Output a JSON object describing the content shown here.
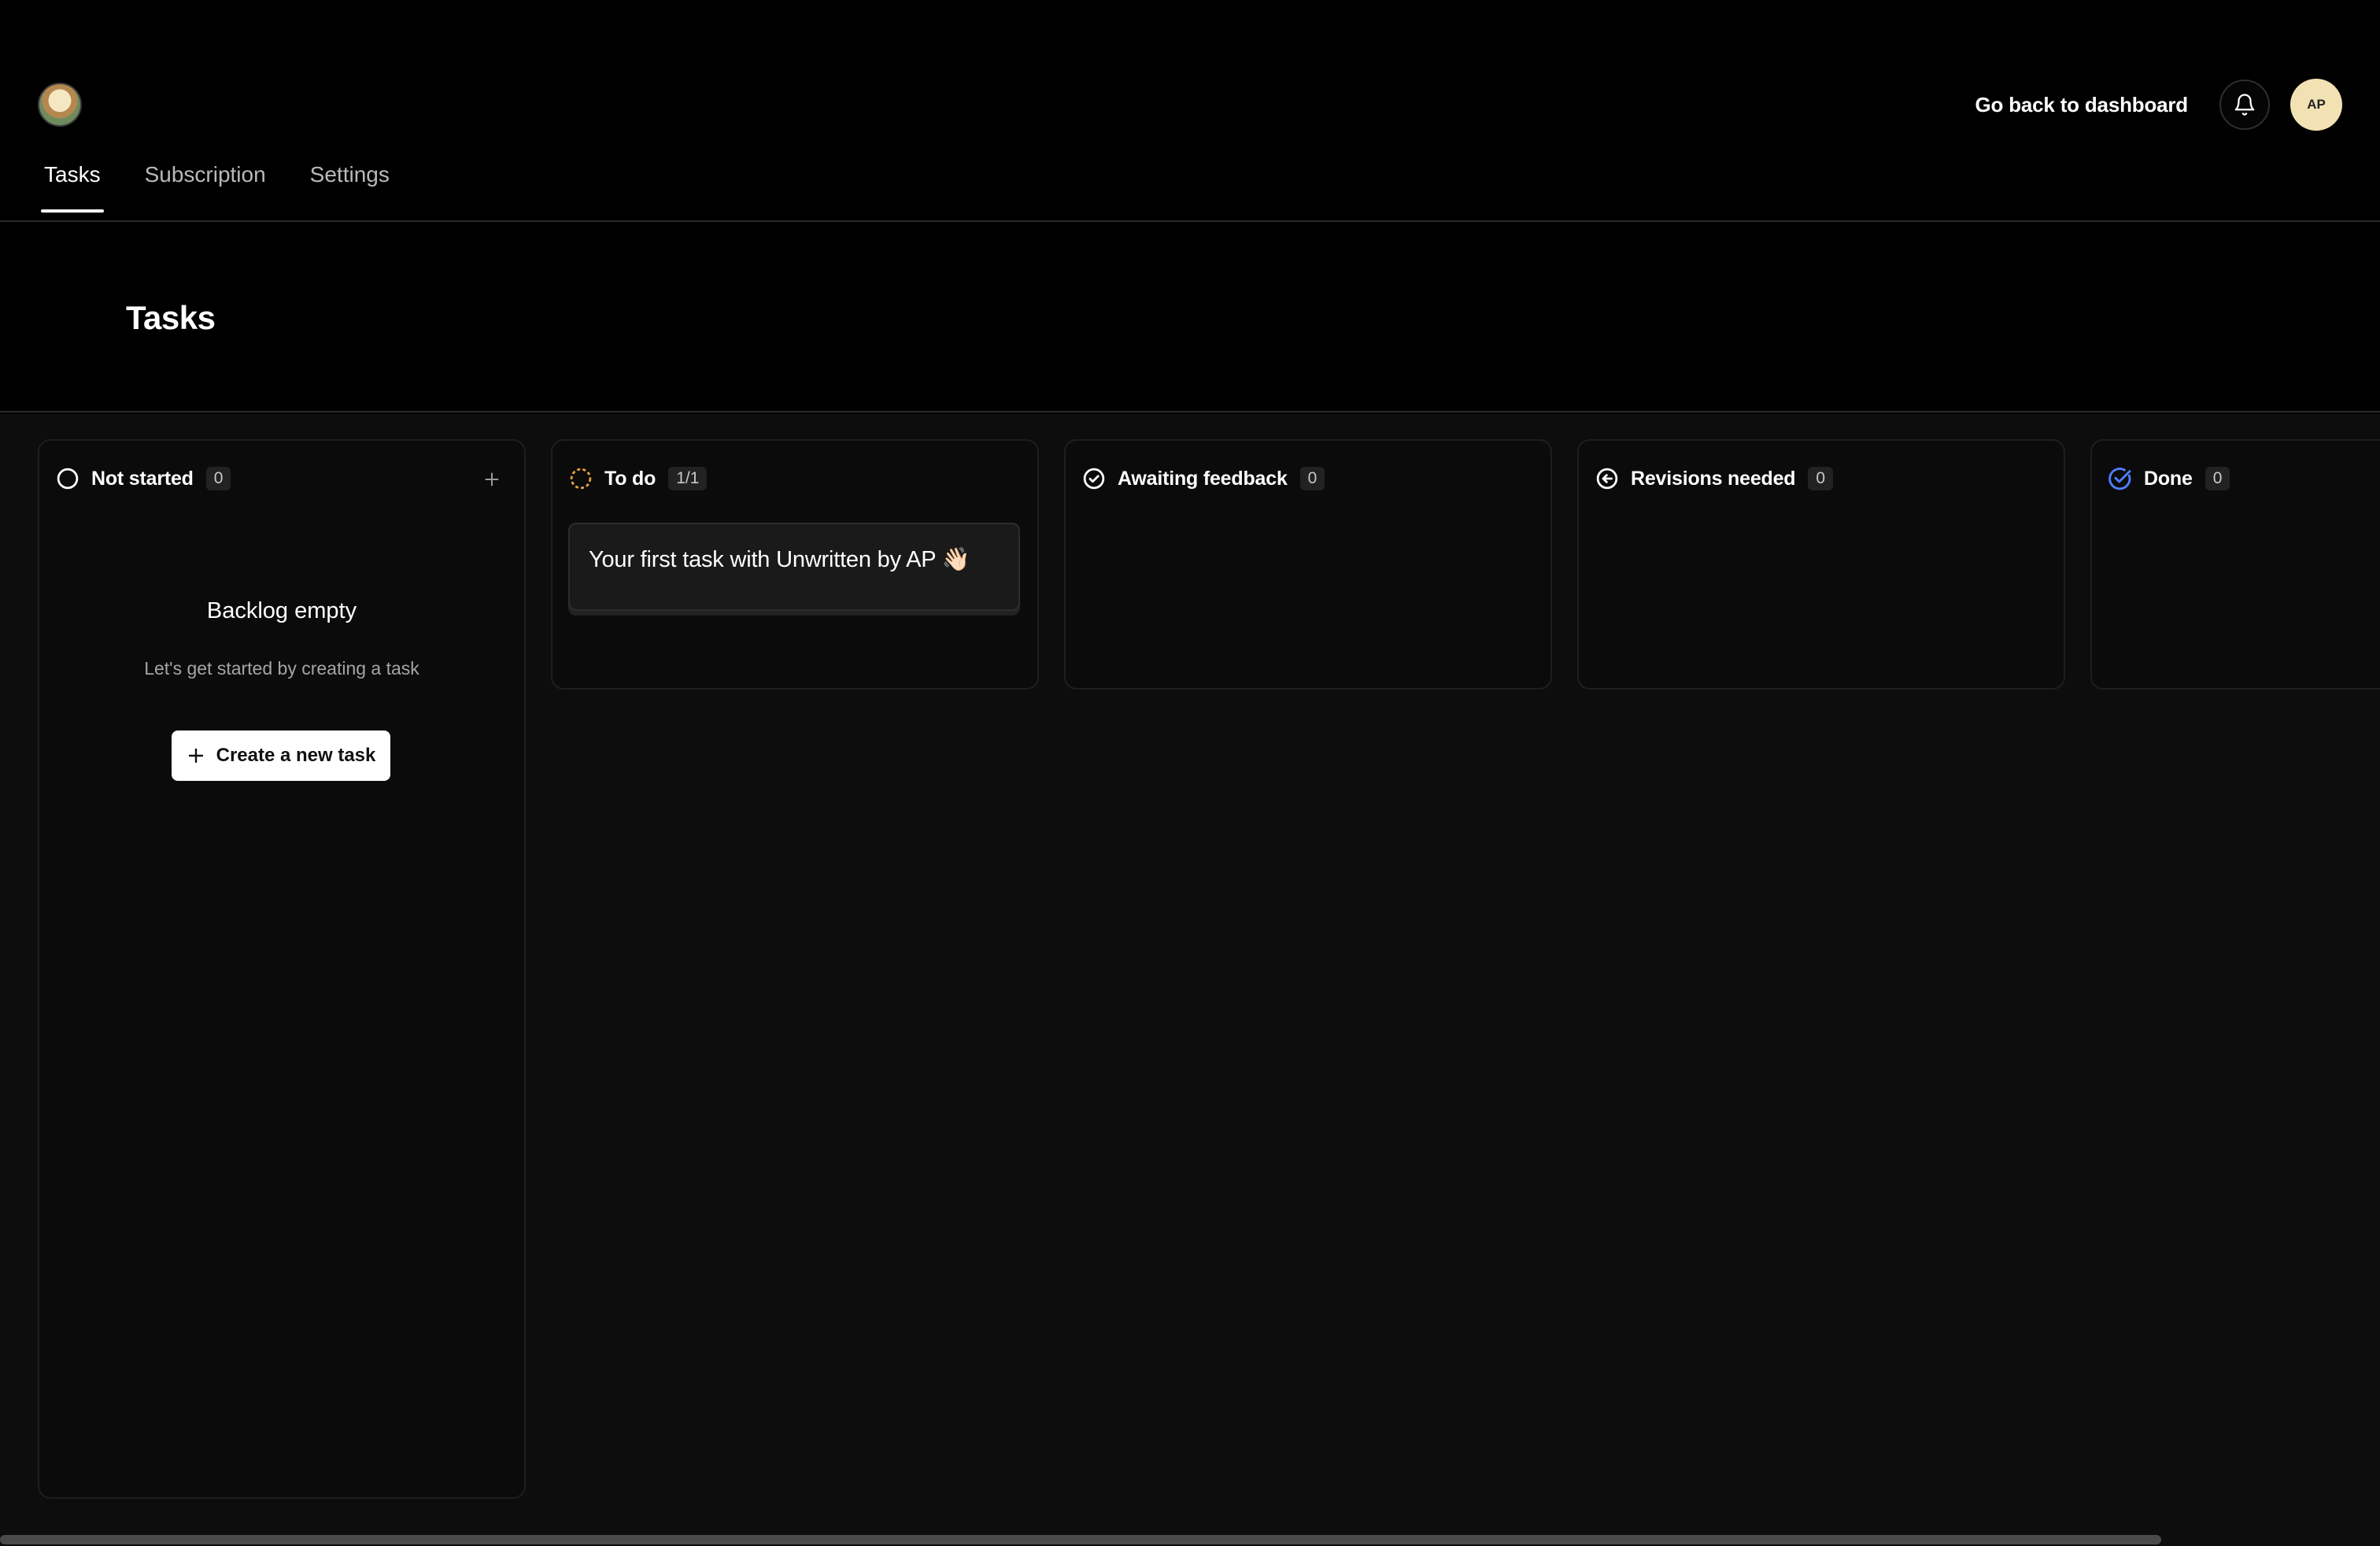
{
  "header": {
    "logo_name": "app-logo",
    "back_link": "Go back to dashboard",
    "avatar_initials": "AP"
  },
  "tabs": [
    {
      "label": "Tasks",
      "active": true
    },
    {
      "label": "Subscription",
      "active": false
    },
    {
      "label": "Settings",
      "active": false
    }
  ],
  "page": {
    "title": "Tasks"
  },
  "columns": [
    {
      "title": "Not started",
      "count": "0",
      "icon": "circle-outline-icon",
      "icon_color": "#ffffff",
      "empty_title": "Backlog empty",
      "empty_subtitle": "Let's get started by creating a task",
      "create_button": "Create a new task"
    },
    {
      "title": "To do",
      "count": "1/1",
      "icon": "dashed-circle-icon",
      "icon_color": "#e8a33d",
      "task": "Your first task with Unwritten by AP 👋🏻"
    },
    {
      "title": "Awaiting feedback",
      "count": "0",
      "icon": "check-circle-icon",
      "icon_color": "#ffffff"
    },
    {
      "title": "Revisions needed",
      "count": "0",
      "icon": "arrow-left-circle-icon",
      "icon_color": "#ffffff"
    },
    {
      "title": "Done",
      "count": "0",
      "icon": "double-check-circle-icon",
      "icon_color": "#4f7dff"
    }
  ]
}
